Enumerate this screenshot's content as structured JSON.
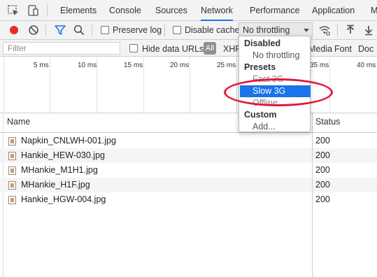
{
  "tabs": {
    "elements": "Elements",
    "console": "Console",
    "sources": "Sources",
    "network": "Network",
    "performance": "Performance",
    "application": "Application",
    "more": "M"
  },
  "toolbar": {
    "preserve_log": "Preserve log",
    "disable_cache": "Disable cache",
    "throttling_value": "No throttling"
  },
  "filter": {
    "placeholder": "Filter",
    "hide_data_urls": "Hide data URLs",
    "all": "All",
    "xhr": "XHR",
    "media": "Media",
    "font": "Font",
    "doc": "Doc"
  },
  "overview": {
    "ticks": [
      "5 ms",
      "10 ms",
      "15 ms",
      "20 ms",
      "25 ms",
      "35 ms",
      "40 ms"
    ]
  },
  "table": {
    "headers": {
      "name": "Name",
      "status": "Status"
    },
    "rows": [
      {
        "name": "Napkin_CNLWH-001.jpg",
        "status": "200"
      },
      {
        "name": "Hankie_HEW-030.jpg",
        "status": "200"
      },
      {
        "name": "MHankie_M1H1.jpg",
        "status": "200"
      },
      {
        "name": "MHankie_H1F.jpg",
        "status": "200"
      },
      {
        "name": "Hankie_HGW-004.jpg",
        "status": "200"
      }
    ]
  },
  "dropdown": {
    "disabled_header": "Disabled",
    "no_throttling": "No throttling",
    "presets_header": "Presets",
    "fast_3g": "Fast 3G",
    "slow_3g": "Slow 3G",
    "offline": "Offline",
    "custom_header": "Custom",
    "add": "Add..."
  },
  "colors": {
    "accent": "#1a73e8",
    "record": "#e52d2d",
    "highlight": "#e2173f"
  }
}
